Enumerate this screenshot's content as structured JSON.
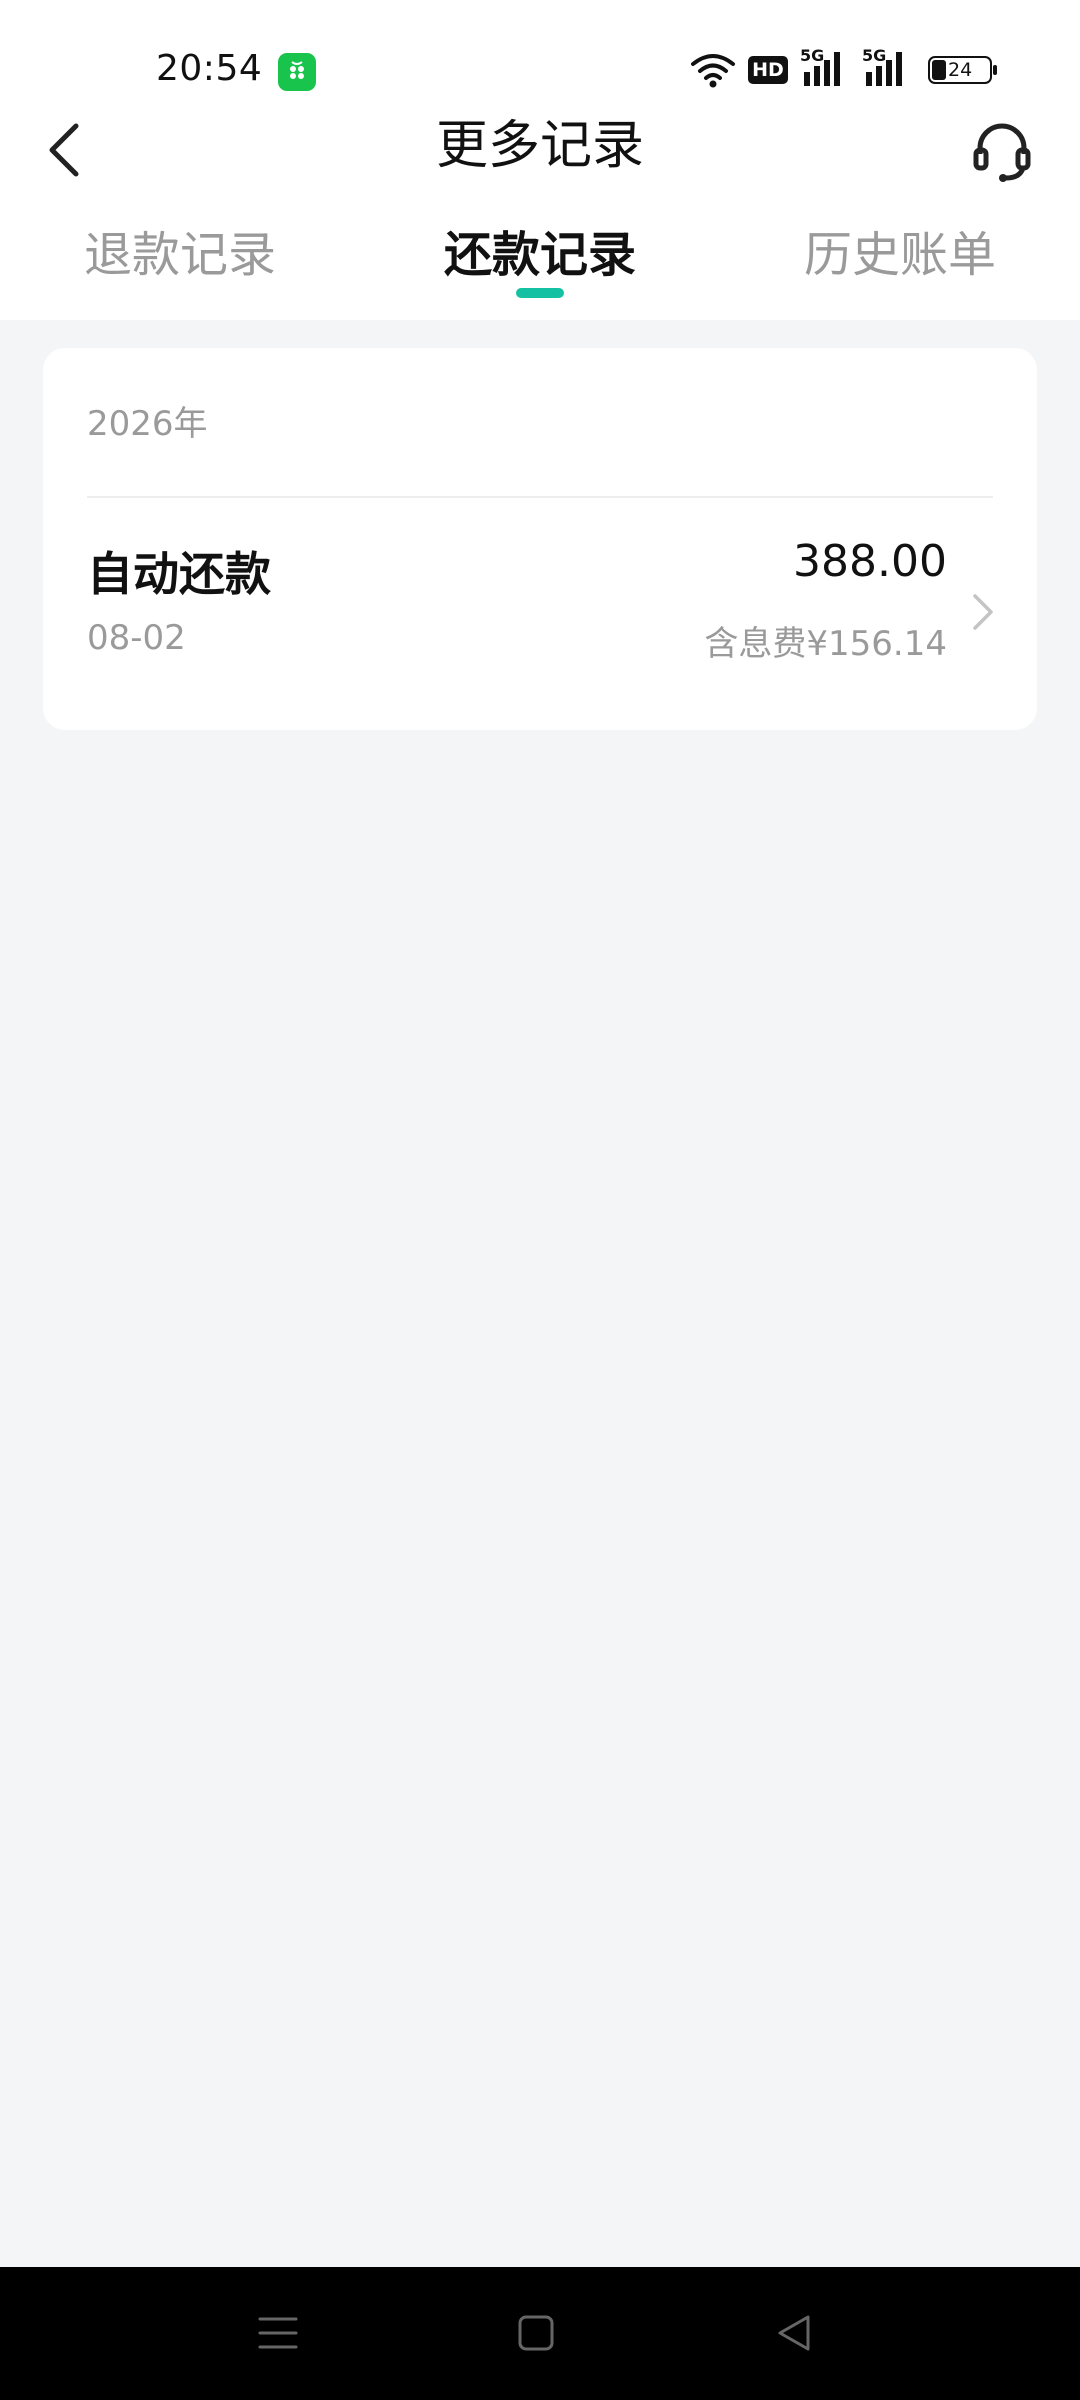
{
  "status_bar": {
    "time": "20:54",
    "network_label": "HD",
    "network_5g_1": "5G",
    "network_5g_2": "5G",
    "battery": "24"
  },
  "header": {
    "title": "更多记录"
  },
  "tabs": [
    {
      "label": "退款记录",
      "active": false
    },
    {
      "label": "还款记录",
      "active": true
    },
    {
      "label": "历史账单",
      "active": false
    }
  ],
  "records": {
    "year": "2026年",
    "items": [
      {
        "title": "自动还款",
        "date": "08-02",
        "amount": "388.00",
        "interest": "含息费¥156.14"
      }
    ]
  },
  "colors": {
    "accent": "#14c2a3",
    "background": "#f3f5f6",
    "card": "#ffffff"
  }
}
